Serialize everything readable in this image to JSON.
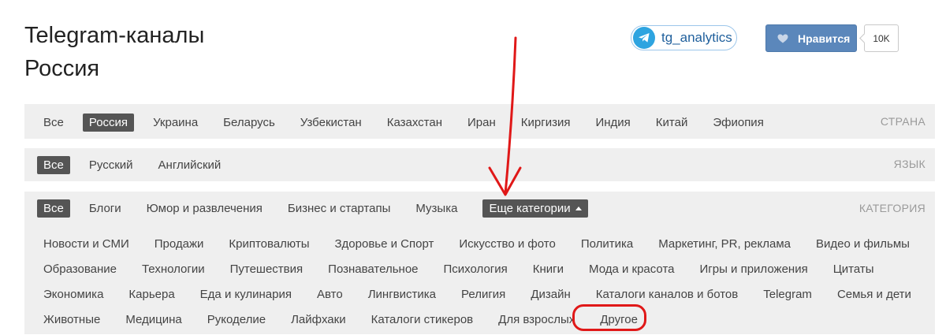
{
  "header": {
    "title_line1": "Telegram-каналы",
    "title_line2": "Россия"
  },
  "telegram_link": {
    "label": "tg_analytics",
    "icon": "telegram-icon"
  },
  "like": {
    "label": "Нравится",
    "count": "10K",
    "icon": "heart-icon",
    "color": "#5b87bb"
  },
  "country_filter": {
    "label": "СТРАНА",
    "items": [
      "Все",
      "Россия",
      "Украина",
      "Беларусь",
      "Узбекистан",
      "Казахстан",
      "Иран",
      "Киргизия",
      "Индия",
      "Китай",
      "Эфиопия"
    ],
    "selected": "Россия"
  },
  "language_filter": {
    "label": "ЯЗЫК",
    "items": [
      "Все",
      "Русский",
      "Английский"
    ],
    "selected": "Все"
  },
  "category_filter": {
    "label": "КАТЕГОРИЯ",
    "items": [
      "Все",
      "Блоги",
      "Юмор и развлечения",
      "Бизнес и стартапы",
      "Музыка"
    ],
    "selected": "Все",
    "more_label": "Еще категории",
    "more_rows": [
      [
        "Новости и СМИ",
        "Продажи",
        "Криптовалюты",
        "Здоровье и Спорт",
        "Искусство и фото",
        "Политика",
        "Маркетинг, PR, реклама",
        "Видео и фильмы"
      ],
      [
        "Образование",
        "Технологии",
        "Путешествия",
        "Познавательное",
        "Психология",
        "Книги",
        "Мода и красота",
        "Игры и приложения",
        "Цитаты"
      ],
      [
        "Экономика",
        "Карьера",
        "Еда и кулинария",
        "Авто",
        "Лингвистика",
        "Религия",
        "Дизайн",
        "Каталоги каналов и ботов",
        "Telegram",
        "Семья и дети"
      ],
      [
        "Животные",
        "Медицина",
        "Рукоделие",
        "Лайфхаки",
        "Каталоги стикеров",
        "Для взрослых",
        "Другое"
      ]
    ]
  },
  "annotation": {
    "color": "#e01818"
  }
}
